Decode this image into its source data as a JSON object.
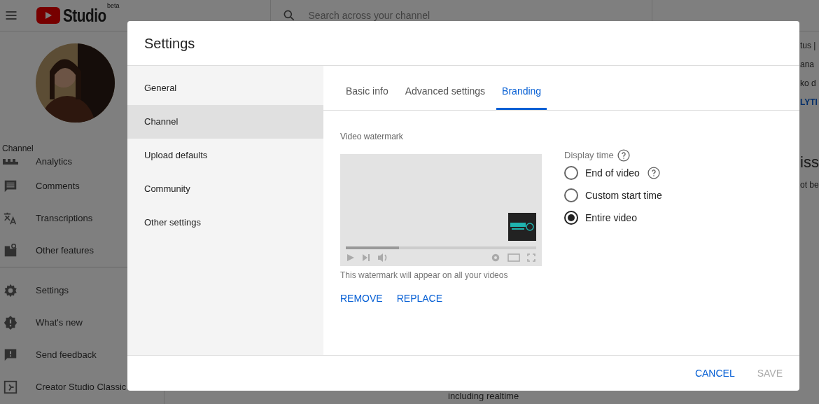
{
  "header": {
    "logo_text": "Studio",
    "logo_badge": "beta",
    "search": {
      "placeholder": "Search across your channel"
    }
  },
  "sidebar": {
    "section_label": "Channel",
    "items": [
      {
        "label": "Analytics"
      },
      {
        "label": "Comments"
      },
      {
        "label": "Transcriptions"
      },
      {
        "label": "Other features"
      },
      {
        "label": "Settings"
      },
      {
        "label": "What's new"
      },
      {
        "label": "Send feedback"
      },
      {
        "label": "Creator Studio Classic"
      }
    ]
  },
  "background_fragments": [
    "tus |",
    "ana",
    "ko d",
    "LYTI",
    "iss",
    "ot be"
  ],
  "background_text": "including realtime",
  "dialog": {
    "title": "Settings",
    "nav": [
      {
        "label": "General",
        "selected": false
      },
      {
        "label": "Channel",
        "selected": true
      },
      {
        "label": "Upload defaults",
        "selected": false
      },
      {
        "label": "Community",
        "selected": false
      },
      {
        "label": "Other settings",
        "selected": false
      }
    ],
    "tabs": [
      {
        "label": "Basic info",
        "selected": false
      },
      {
        "label": "Advanced settings",
        "selected": false
      },
      {
        "label": "Branding",
        "selected": true
      }
    ],
    "watermark": {
      "label": "Video watermark",
      "preview_progress": {
        "level": 0.28
      },
      "caption": "This watermark will appear on all your videos",
      "actions": [
        "REMOVE",
        "REPLACE"
      ]
    },
    "display_time": {
      "label": "Display time",
      "options": [
        {
          "label": "End of video",
          "selected": false,
          "help": true
        },
        {
          "label": "Custom start time",
          "selected": false,
          "help": false
        },
        {
          "label": "Entire video",
          "selected": true,
          "help": false
        }
      ]
    },
    "buttons": [
      {
        "label": "CANCEL",
        "disabled": false
      },
      {
        "label": "SAVE",
        "disabled": true
      }
    ]
  }
}
